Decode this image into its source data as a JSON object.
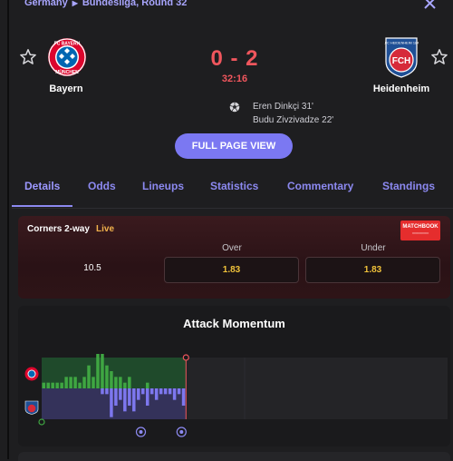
{
  "breadcrumb": {
    "country": "Germany",
    "competition": "Bundesliga, Round 32"
  },
  "match": {
    "home": {
      "name": "Bayern",
      "crest_color": "#dc052d"
    },
    "away": {
      "name": "Heidenheim",
      "crest_color": "#d62a3a"
    },
    "score": "0 - 2",
    "clock": "32:16",
    "scorers": [
      "Eren Dinkçi 31'",
      "Budu Zivzivadze 22'"
    ]
  },
  "actions": {
    "full_page": "FULL PAGE VIEW"
  },
  "tabs": [
    {
      "label": "Details",
      "active": true
    },
    {
      "label": "Odds",
      "active": false
    },
    {
      "label": "Lineups",
      "active": false
    },
    {
      "label": "Statistics",
      "active": false
    },
    {
      "label": "Commentary",
      "active": false
    },
    {
      "label": "Standings",
      "active": false
    }
  ],
  "odds": {
    "market": "Corners 2-way",
    "status": "Live",
    "provider_logo_text": "MATCHBOOK",
    "columns": [
      "Over",
      "Under"
    ],
    "line": "10.5",
    "over": "1.83",
    "under": "1.83"
  },
  "momentum": {
    "title": "Attack Momentum",
    "minute_elapsed": 32,
    "home_color": "#3fa642",
    "away_color": "#7d77ee",
    "home_values": [
      1,
      1,
      1,
      1,
      1,
      2,
      2,
      2,
      1,
      2,
      4,
      2,
      6,
      6,
      4,
      3,
      2,
      2,
      1,
      2,
      0,
      0,
      0,
      1,
      0,
      0,
      0,
      0,
      0,
      0,
      0,
      0
    ],
    "away_values": [
      0,
      0,
      0,
      0,
      0,
      0,
      0,
      0,
      0,
      0,
      0,
      0,
      0,
      1,
      1,
      5,
      3,
      2,
      4,
      3,
      4,
      2,
      1,
      3,
      1,
      2,
      1,
      1,
      1,
      2,
      1,
      3
    ],
    "goal_minutes": [
      22,
      31
    ]
  },
  "colors": {
    "accent": "#8c89f0",
    "score_red": "#f0565d",
    "odds_gold": "#f0c23a",
    "live_orange": "#f2b24c"
  }
}
